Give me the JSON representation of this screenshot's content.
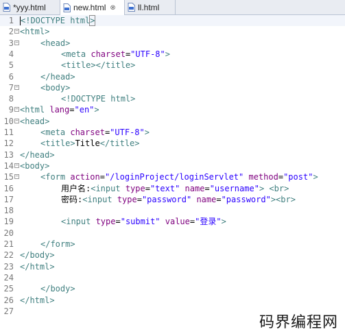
{
  "tabs": [
    {
      "label": "*yyy.html",
      "active": false,
      "icon": "html-file-icon"
    },
    {
      "label": "new.html",
      "active": true,
      "icon": "html-file-icon",
      "close": "⊗"
    },
    {
      "label": "ll.html",
      "active": false,
      "icon": "html-file-icon"
    }
  ],
  "lines": [
    {
      "num": "1",
      "fold": "",
      "indent": 0,
      "tokens": [
        [
          "cursor",
          ""
        ],
        [
          "tag",
          "<!DOCTYPE html"
        ],
        [
          "box",
          ">"
        ]
      ]
    },
    {
      "num": "2",
      "fold": "−",
      "indent": 0,
      "tokens": [
        [
          "tag",
          "<html>"
        ]
      ]
    },
    {
      "num": "3",
      "fold": "−",
      "indent": 1,
      "tokens": [
        [
          "tag",
          "<head>"
        ]
      ]
    },
    {
      "num": "4",
      "fold": "",
      "indent": 2,
      "tokens": [
        [
          "tag",
          "<meta "
        ],
        [
          "attr",
          "charset"
        ],
        [
          "txt",
          "="
        ],
        [
          "val",
          "\"UTF-8\""
        ],
        [
          "tag",
          ">"
        ]
      ]
    },
    {
      "num": "5",
      "fold": "",
      "indent": 2,
      "tokens": [
        [
          "tag",
          "<title></title>"
        ]
      ]
    },
    {
      "num": "6",
      "fold": "",
      "indent": 1,
      "tokens": [
        [
          "tag",
          "</head>"
        ]
      ]
    },
    {
      "num": "7",
      "fold": "−",
      "indent": 1,
      "tokens": [
        [
          "tag",
          "<body>"
        ]
      ]
    },
    {
      "num": "8",
      "fold": "",
      "indent": 2,
      "tokens": [
        [
          "tag",
          "<!DOCTYPE html>"
        ]
      ]
    },
    {
      "num": "9",
      "fold": "−",
      "indent": 0,
      "tokens": [
        [
          "tag",
          "<html "
        ],
        [
          "attr",
          "lang"
        ],
        [
          "txt",
          "="
        ],
        [
          "val",
          "\"en\""
        ],
        [
          "tag",
          ">"
        ]
      ]
    },
    {
      "num": "10",
      "fold": "−",
      "indent": 0,
      "tokens": [
        [
          "tag",
          "<head>"
        ]
      ]
    },
    {
      "num": "11",
      "fold": "",
      "indent": 1,
      "tokens": [
        [
          "tag",
          "<meta "
        ],
        [
          "attr",
          "charset"
        ],
        [
          "txt",
          "="
        ],
        [
          "val",
          "\"UTF-8\""
        ],
        [
          "tag",
          ">"
        ]
      ]
    },
    {
      "num": "12",
      "fold": "",
      "indent": 1,
      "tokens": [
        [
          "tag",
          "<title>"
        ],
        [
          "txt",
          "Title"
        ],
        [
          "tag",
          "</title>"
        ]
      ]
    },
    {
      "num": "13",
      "fold": "",
      "indent": 0,
      "tokens": [
        [
          "tag",
          "</head>"
        ]
      ]
    },
    {
      "num": "14",
      "fold": "−",
      "indent": 0,
      "tokens": [
        [
          "tag",
          "<body>"
        ]
      ]
    },
    {
      "num": "15",
      "fold": "−",
      "indent": 1,
      "tokens": [
        [
          "tag",
          "<form "
        ],
        [
          "attr",
          "action"
        ],
        [
          "txt",
          "="
        ],
        [
          "val",
          "\"/loginProject/loginServlet\""
        ],
        [
          "txt",
          " "
        ],
        [
          "attr",
          "method"
        ],
        [
          "txt",
          "="
        ],
        [
          "val",
          "\"post\""
        ],
        [
          "tag",
          ">"
        ]
      ]
    },
    {
      "num": "16",
      "fold": "",
      "indent": 2,
      "tokens": [
        [
          "txt",
          "用户名:"
        ],
        [
          "tag",
          "<input "
        ],
        [
          "attr",
          "type"
        ],
        [
          "txt",
          "="
        ],
        [
          "val",
          "\"text\""
        ],
        [
          "txt",
          " "
        ],
        [
          "attr",
          "name"
        ],
        [
          "txt",
          "="
        ],
        [
          "val",
          "\"username\""
        ],
        [
          "tag",
          ">"
        ],
        [
          "txt",
          " "
        ],
        [
          "tag",
          "<br>"
        ]
      ]
    },
    {
      "num": "17",
      "fold": "",
      "indent": 2,
      "tokens": [
        [
          "txt",
          "密码:"
        ],
        [
          "tag",
          "<input "
        ],
        [
          "attr",
          "type"
        ],
        [
          "txt",
          "="
        ],
        [
          "val",
          "\"password\""
        ],
        [
          "txt",
          " "
        ],
        [
          "attr",
          "name"
        ],
        [
          "txt",
          "="
        ],
        [
          "val",
          "\"password\""
        ],
        [
          "tag",
          ">"
        ],
        [
          "tag",
          "<br>"
        ]
      ]
    },
    {
      "num": "18",
      "fold": "",
      "indent": 0,
      "tokens": []
    },
    {
      "num": "19",
      "fold": "",
      "indent": 2,
      "tokens": [
        [
          "tag",
          "<input "
        ],
        [
          "attr",
          "type"
        ],
        [
          "txt",
          "="
        ],
        [
          "val",
          "\"submit\""
        ],
        [
          "txt",
          " "
        ],
        [
          "attr",
          "value"
        ],
        [
          "txt",
          "="
        ],
        [
          "val",
          "\"登录\""
        ],
        [
          "tag",
          ">"
        ]
      ]
    },
    {
      "num": "20",
      "fold": "",
      "indent": 0,
      "tokens": []
    },
    {
      "num": "21",
      "fold": "",
      "indent": 1,
      "tokens": [
        [
          "tag",
          "</form>"
        ]
      ]
    },
    {
      "num": "22",
      "fold": "",
      "indent": 0,
      "tokens": [
        [
          "tag",
          "</body>"
        ]
      ]
    },
    {
      "num": "23",
      "fold": "",
      "indent": 0,
      "tokens": [
        [
          "tag",
          "</html>"
        ]
      ]
    },
    {
      "num": "24",
      "fold": "",
      "indent": 0,
      "tokens": []
    },
    {
      "num": "25",
      "fold": "",
      "indent": 1,
      "tokens": [
        [
          "tag",
          "</body>"
        ]
      ]
    },
    {
      "num": "26",
      "fold": "",
      "indent": 0,
      "tokens": [
        [
          "tag",
          "</html>"
        ]
      ]
    },
    {
      "num": "27",
      "fold": "",
      "indent": 0,
      "tokens": []
    }
  ],
  "watermark": "码界编程网",
  "colors": {
    "tag": "#3f7f7f",
    "attr": "#7f007f",
    "value": "#2a00ff",
    "text": "#000000",
    "line_number": "#787878"
  }
}
